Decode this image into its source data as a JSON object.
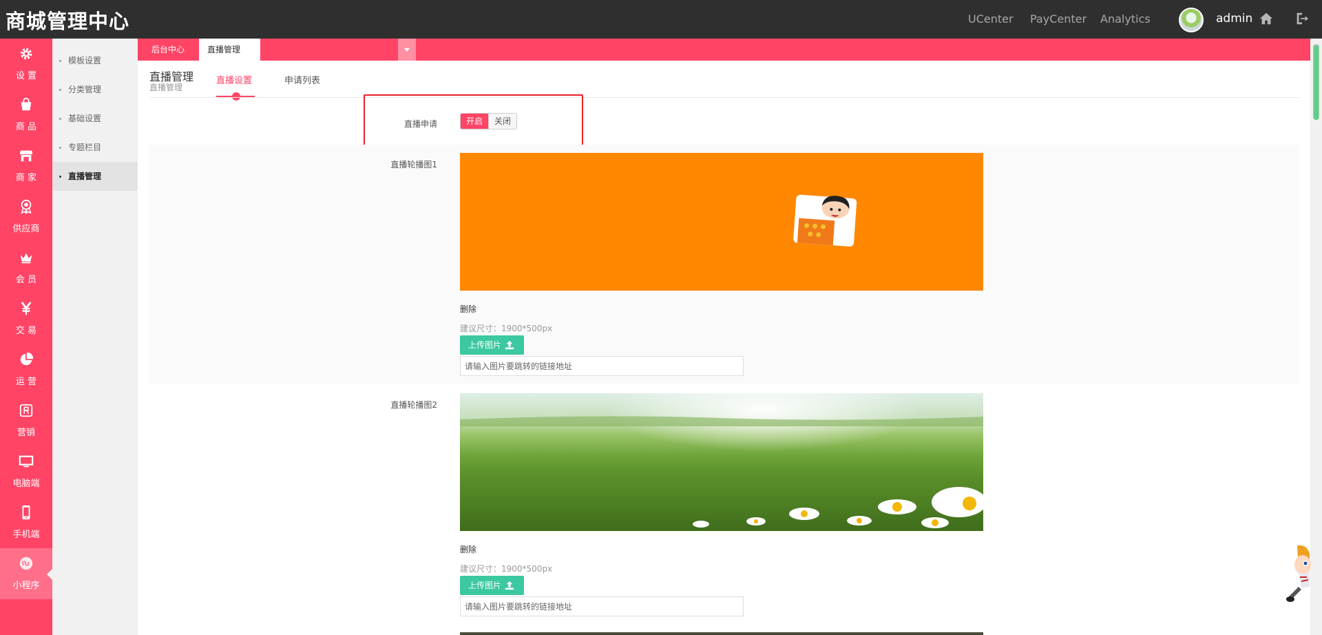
{
  "header": {
    "title": "商城管理中心",
    "nav": [
      "UCenter",
      "PayCenter",
      "Analytics"
    ],
    "username": "admin"
  },
  "rail": [
    {
      "label": "设 置",
      "icon": "gear-icon"
    },
    {
      "label": "商 品",
      "icon": "bag-icon"
    },
    {
      "label": "商 家",
      "icon": "store-icon"
    },
    {
      "label": "供应商",
      "icon": "badge-icon"
    },
    {
      "label": "会 员",
      "icon": "crown-icon"
    },
    {
      "label": "交 易",
      "icon": "yen-icon"
    },
    {
      "label": "运 营",
      "icon": "pie-icon"
    },
    {
      "label": "营销",
      "icon": "promo-icon"
    },
    {
      "label": "电脑端",
      "icon": "monitor-icon"
    },
    {
      "label": "手机端",
      "icon": "phone-icon"
    },
    {
      "label": "小程序",
      "icon": "miniapp-icon"
    }
  ],
  "submenu": [
    "模板设置",
    "分类管理",
    "基础设置",
    "专题栏目",
    "直播管理"
  ],
  "page_tabs": [
    {
      "label": "后台中心"
    },
    {
      "label": "直播管理",
      "close": "×"
    }
  ],
  "page": {
    "title": "直播管理",
    "subtitle": "直播管理",
    "tabs": [
      "直播设置",
      "申请列表"
    ]
  },
  "form": {
    "apply_label": "直播申请",
    "toggle_on": "开启",
    "toggle_off": "关闭",
    "carousel": [
      {
        "label": "直播轮播图1",
        "delete": "删除",
        "hint": "建议尺寸：1900*500px",
        "upload": "上传图片",
        "placeholder": "请输入图片要跳转的链接地址"
      },
      {
        "label": "直播轮播图2",
        "delete": "删除",
        "hint": "建议尺寸：1900*500px",
        "upload": "上传图片",
        "placeholder": "请输入图片要跳转的链接地址"
      }
    ]
  },
  "colors": {
    "brand_red": "#ff4466",
    "upload_green": "#3cc8a0",
    "banner_orange": "#ff8800"
  }
}
